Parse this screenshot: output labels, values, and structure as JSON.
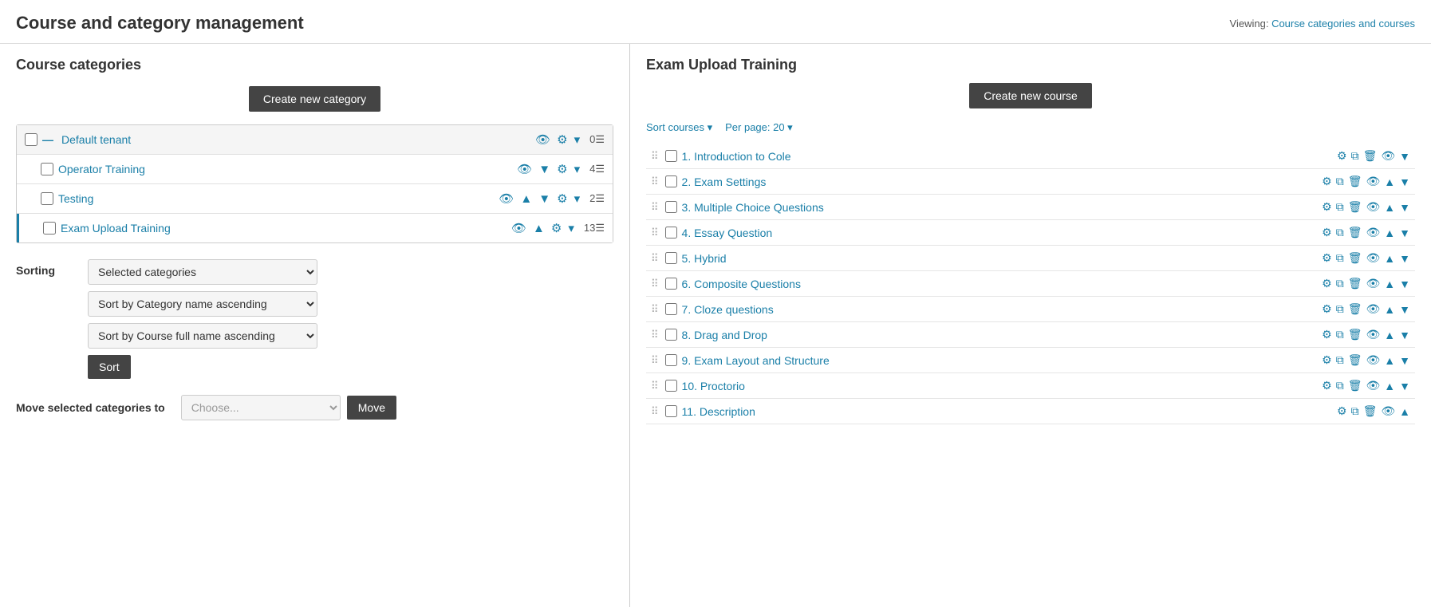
{
  "page": {
    "title": "Course and category management",
    "viewing_label": "Viewing:",
    "viewing_link": "Course categories and courses"
  },
  "left_panel": {
    "title": "Course categories",
    "create_btn": "Create new category",
    "categories": [
      {
        "id": "default-tenant",
        "name": "Default tenant",
        "level": "parent",
        "count": "0",
        "has_dash": true,
        "active": false
      },
      {
        "id": "operator-training",
        "name": "Operator Training",
        "level": "child",
        "count": "4",
        "has_dash": false,
        "active": false
      },
      {
        "id": "testing",
        "name": "Testing",
        "level": "child",
        "count": "2",
        "has_dash": false,
        "active": false
      },
      {
        "id": "exam-upload-training",
        "name": "Exam Upload Training",
        "level": "child",
        "count": "13",
        "has_dash": false,
        "active": true
      }
    ],
    "sorting": {
      "label": "Sorting",
      "scope_options": [
        "Selected categories"
      ],
      "sort_options_1": [
        "Sort by Category name ascending"
      ],
      "sort_options_2": [
        "Sort by Course full name ascending"
      ],
      "sort_btn": "Sort"
    },
    "move": {
      "label": "Move selected categories to",
      "placeholder": "Choose...",
      "move_btn": "Move"
    }
  },
  "right_panel": {
    "title": "Exam Upload Training",
    "create_btn": "Create new course",
    "sort_courses_label": "Sort courses ▾",
    "per_page_label": "Per page: 20 ▾",
    "courses": [
      {
        "num": 1,
        "name": "1. Introduction to Cole"
      },
      {
        "num": 2,
        "name": "2. Exam Settings"
      },
      {
        "num": 3,
        "name": "3. Multiple Choice Questions"
      },
      {
        "num": 4,
        "name": "4. Essay Question"
      },
      {
        "num": 5,
        "name": "5. Hybrid"
      },
      {
        "num": 6,
        "name": "6. Composite Questions"
      },
      {
        "num": 7,
        "name": "7. Cloze questions"
      },
      {
        "num": 8,
        "name": "8. Drag and Drop"
      },
      {
        "num": 9,
        "name": "9. Exam Layout and Structure"
      },
      {
        "num": 10,
        "name": "10. Proctorio"
      },
      {
        "num": 11,
        "name": "11. Description"
      }
    ]
  }
}
